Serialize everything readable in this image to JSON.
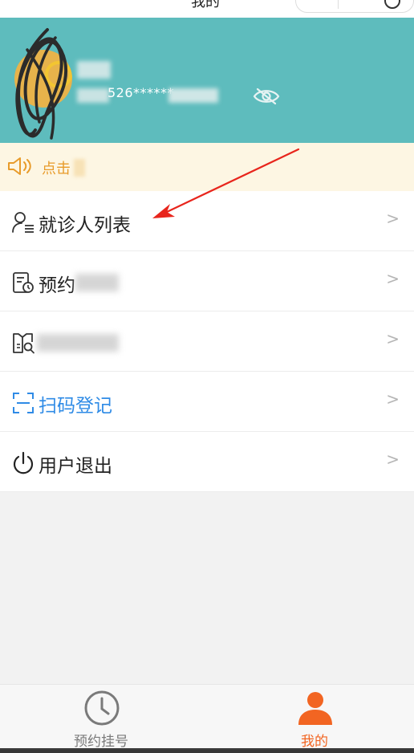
{
  "navbar": {
    "title": "我的"
  },
  "profile": {
    "id_masked": "526******"
  },
  "notice": {
    "text": "点击"
  },
  "menu": {
    "items": [
      {
        "label": "就诊人列表",
        "chevron": ">"
      },
      {
        "label": "预约",
        "chevron": ">"
      },
      {
        "label": "",
        "chevron": ">"
      },
      {
        "label": "扫码登记",
        "chevron": ">"
      },
      {
        "label": "用户退出",
        "chevron": ">"
      }
    ]
  },
  "tabbar": {
    "tabs": [
      {
        "label": "预约挂号",
        "active": false
      },
      {
        "label": "我的",
        "active": true
      }
    ]
  },
  "colors": {
    "header_bg": "#5ebcbd",
    "notice_bg": "#fdf6e3",
    "notice_text": "#e89b2a",
    "accent_orange": "#f26522",
    "link_blue": "#2f8be6",
    "annotation_red": "#e8251c"
  },
  "icons": {
    "eye": "eye-slash-icon",
    "speaker": "speaker-icon",
    "patient_list": "user-list-icon",
    "appointment_record": "document-clock-icon",
    "report": "book-search-icon",
    "scan": "scan-frame-icon",
    "logout": "power-icon",
    "tab_register": "clock-icon",
    "tab_mine": "person-icon"
  }
}
